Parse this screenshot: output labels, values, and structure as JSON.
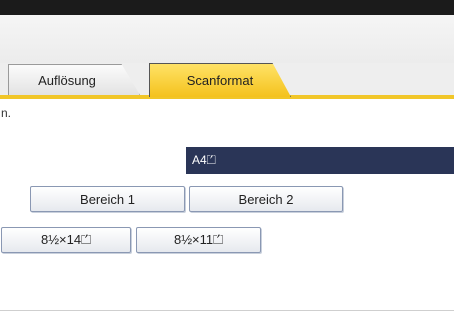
{
  "tabs": [
    {
      "label": "Auflösung",
      "active": false
    },
    {
      "label": "Scanformat",
      "active": true
    }
  ],
  "note_text": "n.",
  "selected_format": "A4⏍",
  "area_buttons": [
    {
      "label": "Bereich 1"
    },
    {
      "label": "Bereich 2"
    }
  ],
  "size_buttons": [
    {
      "label": "8½×14⏍"
    },
    {
      "label": "8½×11⏍"
    }
  ],
  "colors": {
    "active_tab": "#f4c21d",
    "selected_bar": "#2a3557",
    "button_border": "#8a98b3"
  }
}
